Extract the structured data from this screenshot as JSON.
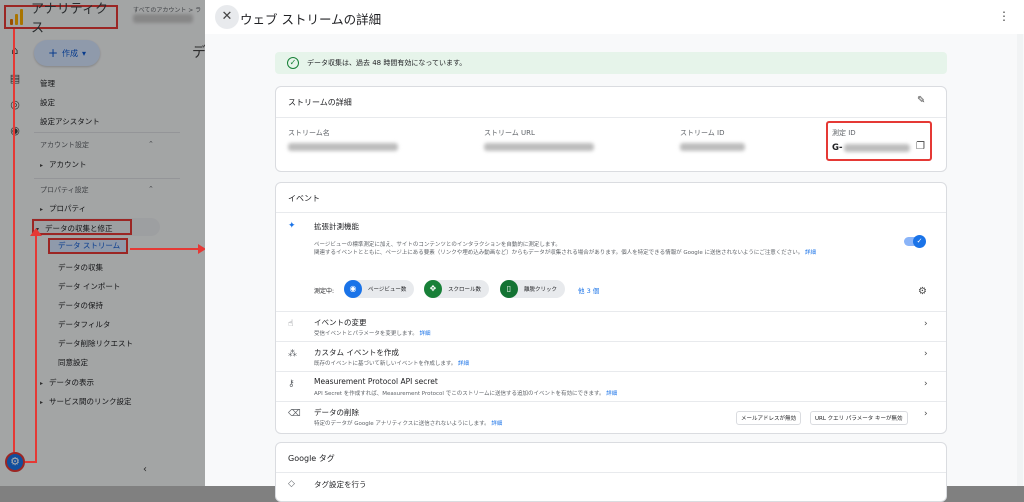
{
  "app": {
    "name": "アナリティクス",
    "breadcrumb": "すべてのアカウント > ラ",
    "create_label": "作成",
    "page_title_partial": "デ"
  },
  "sidebar": {
    "top_items": [
      "管理",
      "設定",
      "設定アシスタント"
    ],
    "account_section": "アカウント設定",
    "account_item": "アカウント",
    "property_section": "プロパティ設定",
    "property_item": "プロパティ",
    "data_collection": "データの収集と修正",
    "sub_items": [
      "データ ストリーム",
      "データの収集",
      "データ インポート",
      "データの保持",
      "データフィルタ",
      "データ削除リクエスト",
      "同意設定"
    ],
    "data_display": "データの表示",
    "service_links": "サービス間のリンク設定"
  },
  "drawer": {
    "title": "ウェブ ストリームの詳細",
    "banner": "データ収集は、過去 48 時間有効になっています。",
    "stream_details": {
      "title": "ストリームの詳細",
      "name_label": "ストリーム名",
      "url_label": "ストリーム URL",
      "id_label": "ストリーム ID",
      "measurement_label": "測定 ID",
      "measurement_prefix": "G-"
    },
    "events": {
      "title": "イベント",
      "enhanced": {
        "title": "拡張計測機能",
        "desc1": "ページビューの標準測定に加え、サイトのコンテンツとのインタラクションを自動的に測定します。",
        "desc2": "関連するイベントとともに、ページ上にある要素（リンクや埋め込み動画など）からもデータが収集される場合があります。個人を特定できる情報が Google に送信されないようにご注意ください。",
        "link": "詳細",
        "measuring_label": "測定中:",
        "chips": [
          "ページビュー数",
          "スクロール数",
          "離脱クリック"
        ],
        "more": "他 3 個"
      },
      "rows": [
        {
          "title": "イベントの変更",
          "desc": "受信イベントとパラメータを変更します。",
          "link": "詳細"
        },
        {
          "title": "カスタム イベントを作成",
          "desc": "既存のイベントに基づいて新しいイベントを作成します。",
          "link": "詳細"
        },
        {
          "title": "Measurement Protocol API secret",
          "desc": "API Secret を作成すれば、Measurement Protocol でこのストリームに送信する追加のイベントを有効にできます。",
          "link": "詳細"
        },
        {
          "title": "データの削除",
          "desc": "特定のデータが Google アナリティクスに送信されないようにします。",
          "link": "詳細"
        }
      ],
      "pills": [
        "メールアドレスが無効",
        "URL クエリ パラメータ キーが無効"
      ]
    },
    "google_tag": {
      "title": "Google タグ",
      "row1": "タグ設定を行う"
    }
  }
}
